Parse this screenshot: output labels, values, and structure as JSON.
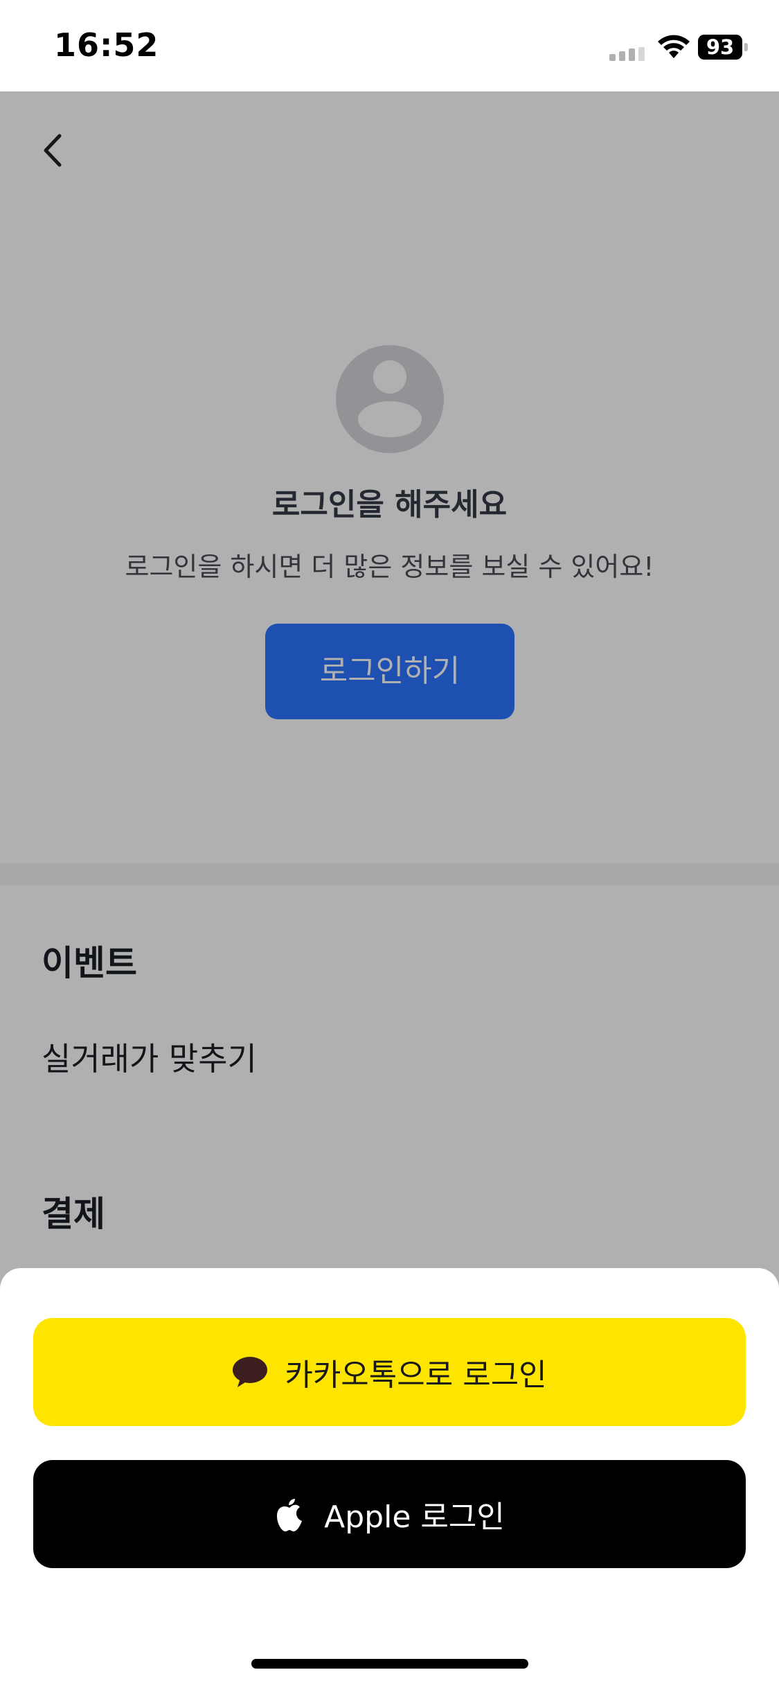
{
  "status_bar": {
    "time": "16:52",
    "battery": "93"
  },
  "header": {
    "back_icon": "chevron-left-icon"
  },
  "profile": {
    "avatar_icon": "person-icon",
    "title": "로그인을 해주세요",
    "subtitle": "로그인을 하시면 더 많은 정보를 보실 수 있어요!",
    "login_button": "로그인하기"
  },
  "sections": [
    {
      "title": "이벤트",
      "items": [
        "실거래가 맞추기"
      ]
    },
    {
      "title": "결제",
      "items": []
    }
  ],
  "login_sheet": {
    "kakao": {
      "label": "카카오톡으로 로그인",
      "icon": "speech-bubble-icon"
    },
    "apple": {
      "label": "Apple 로그인",
      "icon": "apple-logo-icon"
    }
  },
  "colors": {
    "primary_blue": "#2a74ff",
    "kakao_yellow": "#fee500",
    "apple_black": "#000000",
    "dim_overlay": "rgba(0,0,0,0.31)"
  }
}
